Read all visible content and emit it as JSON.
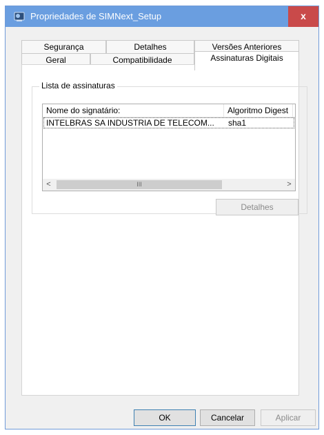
{
  "window": {
    "title": "Propriedades de SIMNext_Setup",
    "close_label": "x"
  },
  "tabs": {
    "row1": [
      {
        "label": "Segurança"
      },
      {
        "label": "Detalhes"
      },
      {
        "label": "Versões Anteriores"
      }
    ],
    "row2": [
      {
        "label": "Geral"
      },
      {
        "label": "Compatibilidade"
      },
      {
        "label": "Assinaturas Digitais",
        "selected": true
      }
    ]
  },
  "signatures": {
    "group_label": "Lista de assinaturas",
    "columns": [
      "Nome do signatário:",
      "Algoritmo Digest"
    ],
    "rows": [
      {
        "name": "INTELBRAS SA INDUSTRIA DE TELECOM...",
        "algorithm": "sha1"
      }
    ],
    "scroll_left": "<",
    "scroll_right": ">",
    "scroll_thumb": "III",
    "details_button": "Detalhes"
  },
  "footer": {
    "ok": "OK",
    "cancel": "Cancelar",
    "apply": "Aplicar"
  }
}
